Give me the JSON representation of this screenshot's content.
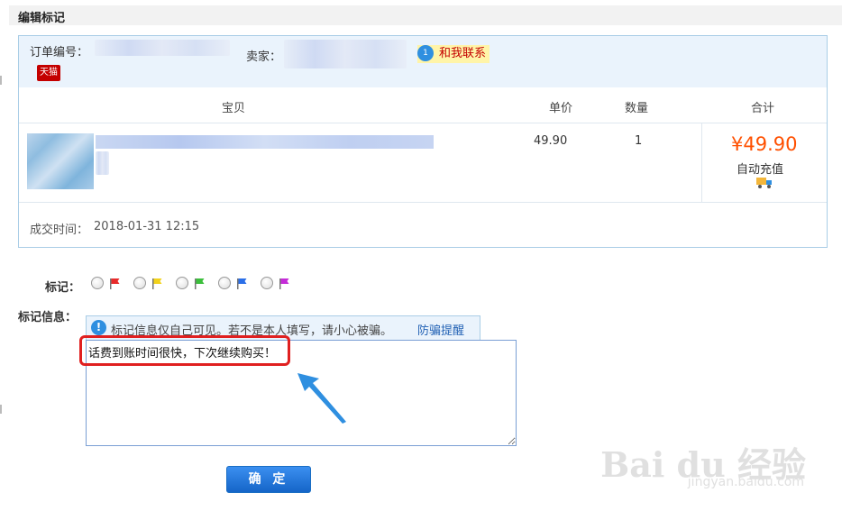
{
  "page_title": "编辑标记",
  "order": {
    "order_no_label": "订单编号：",
    "seller_label": "卖家：",
    "store_badge": "天猫",
    "contact_label": "和我联系",
    "contact_badge": "1",
    "columns": [
      "宝贝",
      "单价",
      "数量",
      "合计"
    ],
    "item": {
      "unit_price": "49.90",
      "quantity": "1",
      "total": "¥49.90",
      "delivery": "自动充值"
    },
    "deal_time_label": "成交时间：",
    "deal_time": "2018-01-31 12:15"
  },
  "flag": {
    "label": "标记：",
    "colors": [
      "#e82b2b",
      "#f2d21c",
      "#3cbf3c",
      "#2b6fe8",
      "#c52bd8"
    ],
    "flag_icons": [
      "red-flag-icon",
      "yellow-flag-icon",
      "green-flag-icon",
      "blue-flag-icon",
      "purple-flag-icon"
    ]
  },
  "memo": {
    "label": "标记信息：",
    "notice": "标记信息仅自己可见。若不是本人填写，请小心被骗。",
    "notice_link": "防骗提醒",
    "notice_icon": "!",
    "value": "话费到账时间很快，下次继续购买！"
  },
  "confirm_button": "确 定",
  "watermark": {
    "main": "Bai du 经验",
    "sub": "jingyan.baidu.com"
  },
  "colors": {
    "accent": "#ff5000",
    "highlight_box": "#e02020",
    "arrow": "#2f8fe0",
    "button": "#1a6ec4"
  }
}
